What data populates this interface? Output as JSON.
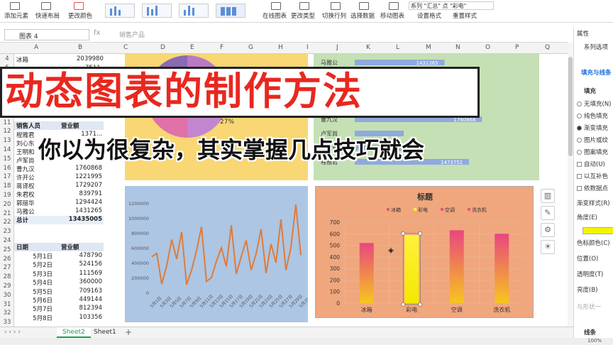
{
  "ribbon": {
    "add_element": "添加元素",
    "quick_layout": "快速布局",
    "change_color": "更改颜色",
    "online_chart": "在线图表",
    "change_type": "更改类型",
    "switch_row_col": "切换行列",
    "select_data": "选择数据",
    "move_chart": "移动图表",
    "series_label": "系列 \"汇总\" 点 \"彩电\"",
    "format_settings": "设置格式",
    "reset_style": "重置样式"
  },
  "formula_bar": {
    "name_box": "图表 4",
    "fx": "fx",
    "value": "销售产品"
  },
  "columns": [
    "A",
    "B",
    "C",
    "D",
    "E",
    "F",
    "G",
    "H",
    "I",
    "J",
    "K",
    "L",
    "M",
    "N",
    "O",
    "P",
    "Q"
  ],
  "rows": [
    "4",
    "5",
    "6",
    "7",
    "8",
    "9",
    "10",
    "11",
    "12",
    "13",
    "14",
    "15",
    "16",
    "17",
    "18",
    "19",
    "20",
    "21",
    "22",
    "23",
    "24",
    "25",
    "26",
    "27",
    "28",
    "29",
    "30",
    "31",
    "32",
    "33"
  ],
  "table_top": {
    "row4_a": "冰箱",
    "row4_b": "2039980",
    "row5_b": "7511"
  },
  "sales_table": {
    "header_name": "销售人员",
    "header_amount": "营业额",
    "rows": [
      {
        "name": "程雅君",
        "amount": "1371..."
      },
      {
        "name": "刘心东",
        "amount": "..."
      },
      {
        "name": "王明和",
        "amount": "..."
      },
      {
        "name": "卢军尚",
        "amount": "..."
      },
      {
        "name": "曹九汉",
        "amount": "1760868"
      },
      {
        "name": "许开公",
        "amount": "1221995"
      },
      {
        "name": "蒋译权",
        "amount": "1729207"
      },
      {
        "name": "朱君权",
        "amount": "839791"
      },
      {
        "name": "郭丽华",
        "amount": "1294424"
      },
      {
        "name": "马雅公",
        "amount": "1431265"
      }
    ],
    "total_label": "总计",
    "total_value": "13435005"
  },
  "date_table": {
    "header_date": "日期",
    "header_amount": "营业额",
    "rows": [
      {
        "date": "5月1日",
        "amount": "478790"
      },
      {
        "date": "5月2日",
        "amount": "524156"
      },
      {
        "date": "5月3日",
        "amount": "111569"
      },
      {
        "date": "5月4日",
        "amount": "360000"
      },
      {
        "date": "5月5日",
        "amount": "709163"
      },
      {
        "date": "5月6日",
        "amount": "449144"
      },
      {
        "date": "5月7日",
        "amount": "812394"
      },
      {
        "date": "5月8日",
        "amount": "103356"
      }
    ]
  },
  "pie_panel": {
    "pct": "27%",
    "legend": "空调"
  },
  "hbar_panel": {
    "labels": [
      "马雅公",
      "郭丽华",
      "蒋译权",
      "许开公",
      "曹九汉",
      "卢军尚",
      "王明和",
      "程雅君"
    ],
    "value_labels": [
      "1431265",
      "1294424",
      "",
      "1221995",
      "1760868",
      "",
      "",
      "1473752"
    ]
  },
  "line_panel": {
    "y_ticks": [
      "0",
      "200000",
      "400000",
      "600000",
      "800000",
      "1000000",
      "1200000"
    ],
    "x_labels": [
      "5月1日",
      "5月3日",
      "5月5日",
      "5月7日",
      "5月9日",
      "5月11日",
      "5月13日",
      "5月15日",
      "5月17日",
      "5月19日",
      "5月21日",
      "5月23日",
      "5月25日",
      "5月27日",
      "5月29日",
      "5月31日"
    ]
  },
  "title": {
    "main": "动态图表的制作方法",
    "sub": "你以为很复杂，其实掌握几点技巧就会"
  },
  "chart_data": {
    "type": "bar",
    "title": "标题",
    "legend_position": "top",
    "categories": [
      "冰箱",
      "彩电",
      "空调",
      "洗衣机"
    ],
    "series": [
      {
        "name": "冰箱",
        "values": [
          520,
          null,
          null,
          null
        ]
      },
      {
        "name": "彩电",
        "values": [
          null,
          590,
          null,
          null
        ]
      },
      {
        "name": "空调",
        "values": [
          null,
          null,
          630,
          null
        ]
      },
      {
        "name": "洗衣机",
        "values": [
          null,
          null,
          null,
          600
        ]
      }
    ],
    "values": [
      520,
      590,
      630,
      600
    ],
    "ylim": [
      0,
      700
    ],
    "yticks": [
      0,
      100,
      200,
      300,
      400,
      500,
      600,
      700
    ],
    "grid": true,
    "colors": {
      "gradient_top": "#e8467f",
      "gradient_bottom": "#f7c520",
      "selected_top": "#fff23a",
      "bg": "#f0a77e"
    }
  },
  "right_pane": {
    "header": "属性",
    "section_series": "系列选项",
    "tab_fill": "填充与线条",
    "fill_title": "填充",
    "options": [
      "无填充(N)",
      "纯色填充",
      "渐变填充",
      "图片或纹",
      "图案填充",
      "自动(U)",
      "以互补色",
      "依数据点"
    ],
    "gradient_style": "渐变样式(R)",
    "angle": "角度(E)",
    "color_label": "色标颜色(C)",
    "position": "位置(O)",
    "transparency": "透明度(T)",
    "brightness": "亮度(B)",
    "same_as": "与形状一",
    "line_title": "线条"
  },
  "tabs": {
    "sheet2": "Sheet2",
    "sheet1": "Sheet1",
    "add": "+"
  },
  "status": {
    "zoom": "100%"
  }
}
